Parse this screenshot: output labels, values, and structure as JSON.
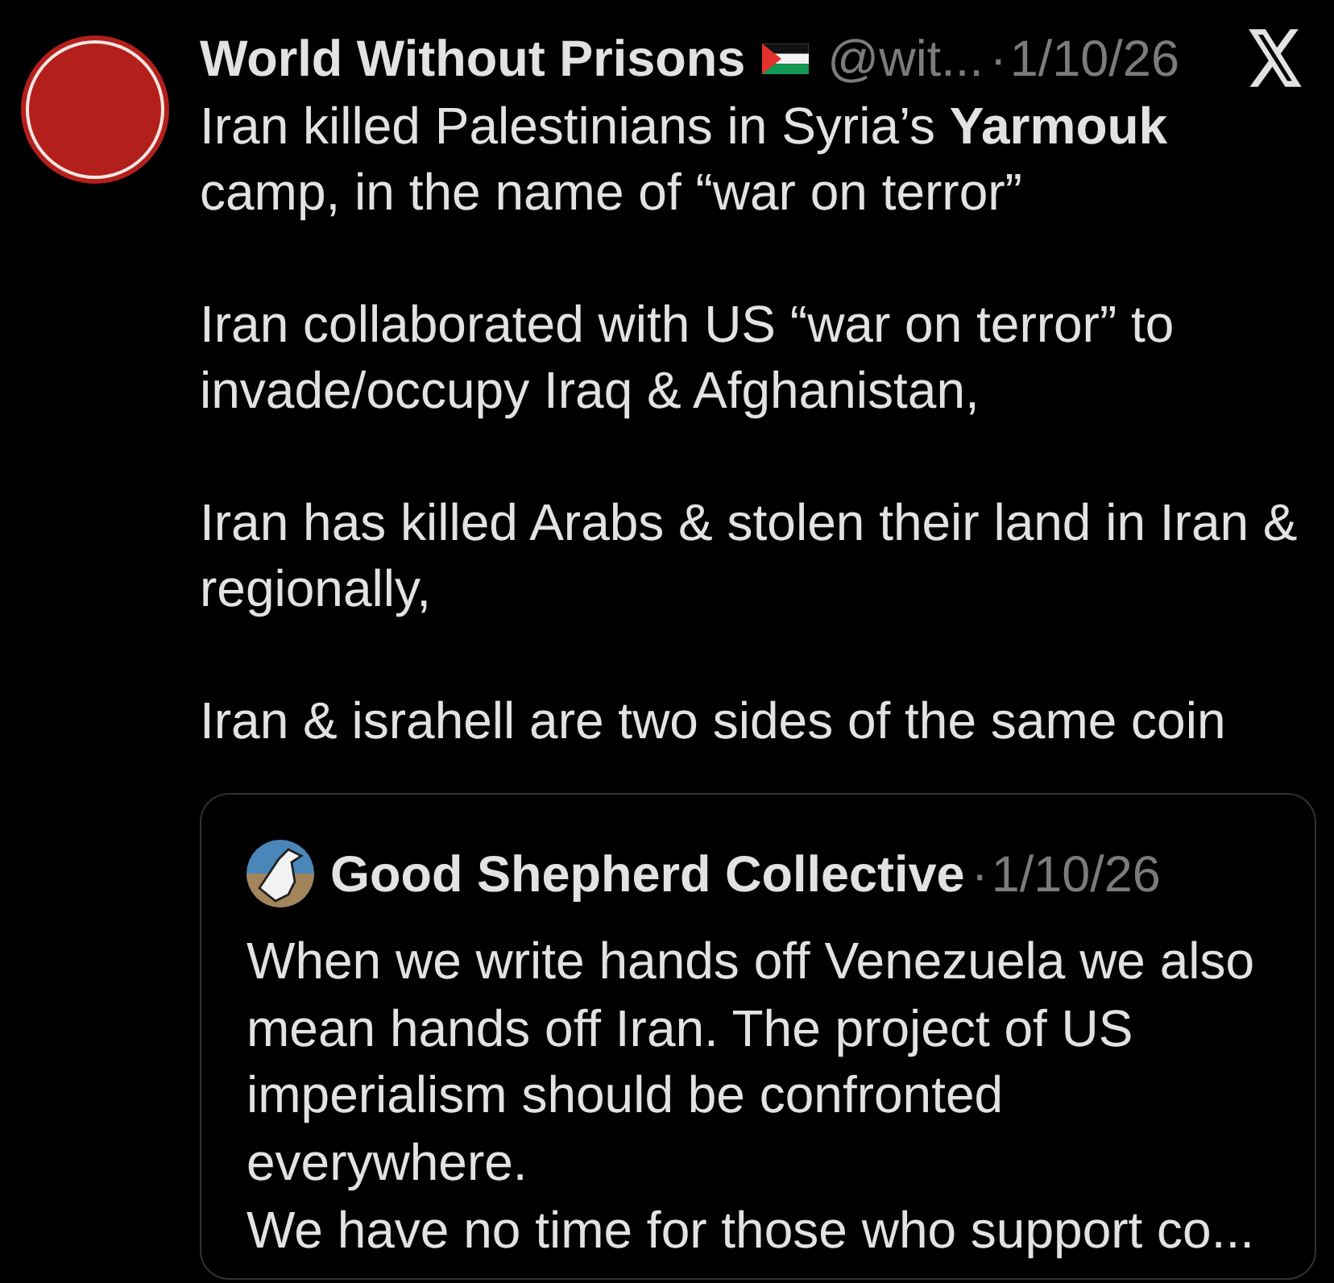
{
  "post": {
    "author": "World Without Prisons",
    "handle": "@wit...",
    "separator": "·",
    "date": "1/10/26",
    "paragraphs": [
      "Iran killed Palestinians in Syria’s **Yarmouk**\ncamp, in the name of “war on terror”",
      "Iran collaborated with US “war on terror” to\ninvade/occupy Iraq & Afghanistan,",
      "Iran has killed Arabs & stolen their land in Iran &\nregionally,",
      "Iran & israhell are two sides of the same coin"
    ]
  },
  "quoted_post": {
    "author": "Good Shepherd Collective",
    "separator": "·",
    "date": "1/10/26",
    "text": "When we write hands off Venezuela we also\nmean hands off Iran. The project of US\nimperialism should be confronted\neverywhere.\nWe have no time for those who support co..."
  }
}
